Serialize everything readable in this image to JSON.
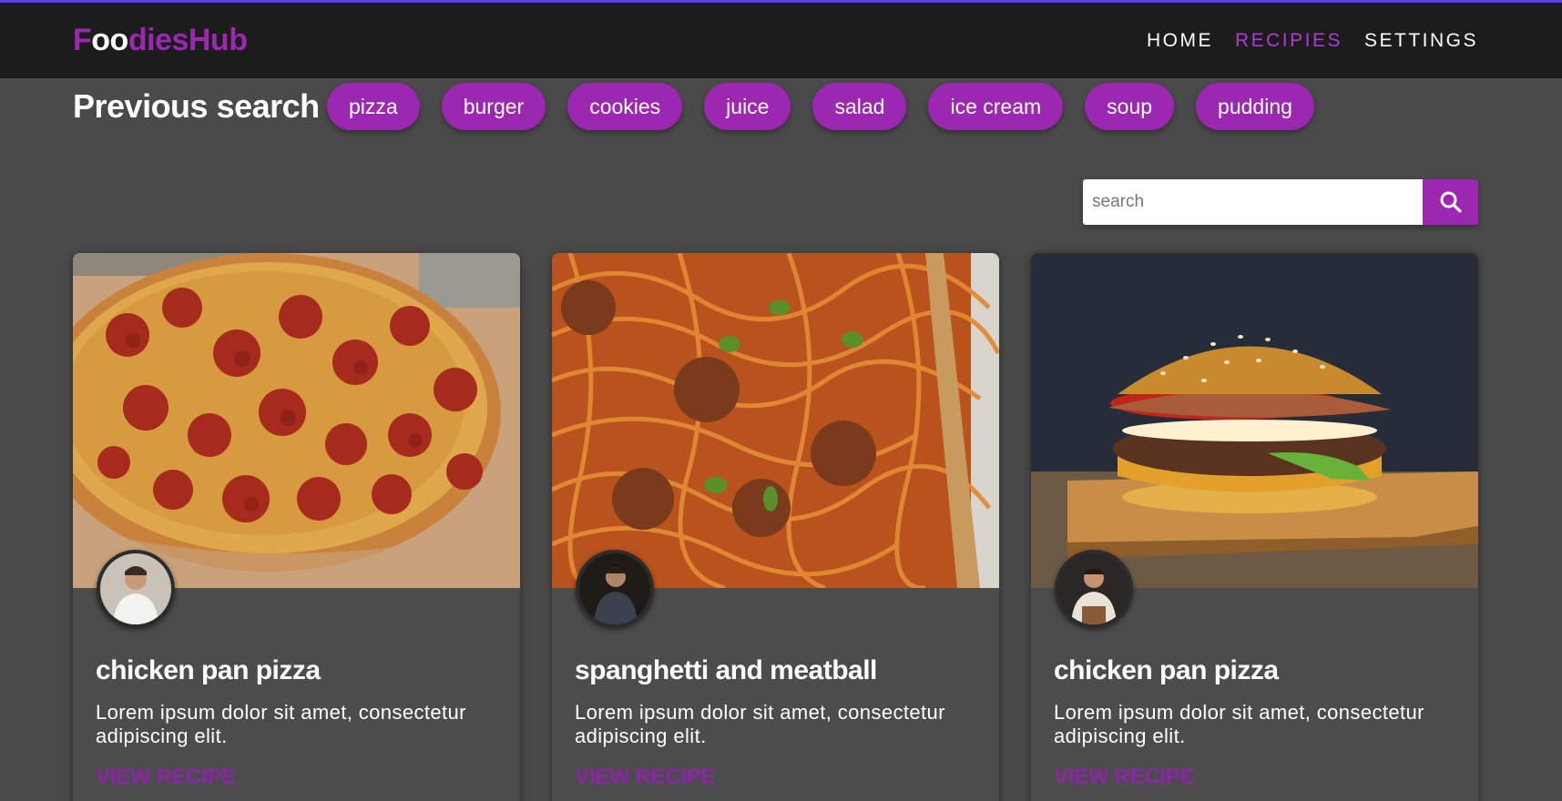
{
  "header": {
    "logo_parts": [
      "F",
      "oo",
      "dies",
      "Hub"
    ],
    "nav": [
      {
        "label": "HOME",
        "active": false
      },
      {
        "label": "RECIPIES",
        "active": true
      },
      {
        "label": "SETTINGS",
        "active": false
      }
    ]
  },
  "previous_search": {
    "title": "Previous search",
    "chips": [
      "pizza",
      "burger",
      "cookies",
      "juice",
      "salad",
      "ice cream",
      "soup",
      "pudding"
    ]
  },
  "search": {
    "placeholder": "search",
    "value": "",
    "button_icon": "search-icon"
  },
  "cards": [
    {
      "title": "chicken pan pizza",
      "description": "Lorem ipsum dolor sit amet, consectetur adipiscing elit.",
      "link_label": "VIEW RECIPE",
      "image": "pizza-image",
      "avatar": "chef-avatar"
    },
    {
      "title": "spanghetti and meatball",
      "description": "Lorem ipsum dolor sit amet, consectetur adipiscing elit.",
      "link_label": "VIEW RECIPE",
      "image": "spaghetti-image",
      "avatar": "chef-avatar"
    },
    {
      "title": "chicken pan pizza",
      "description": "Lorem ipsum dolor sit amet, consectetur adipiscing elit.",
      "link_label": "VIEW RECIPE",
      "image": "burger-image",
      "avatar": "chef-avatar"
    }
  ],
  "colors": {
    "accent": "#9c27b0",
    "navbar": "#1c1c1c",
    "background": "#4a4a4a",
    "top_line": "#5b3fd6"
  }
}
